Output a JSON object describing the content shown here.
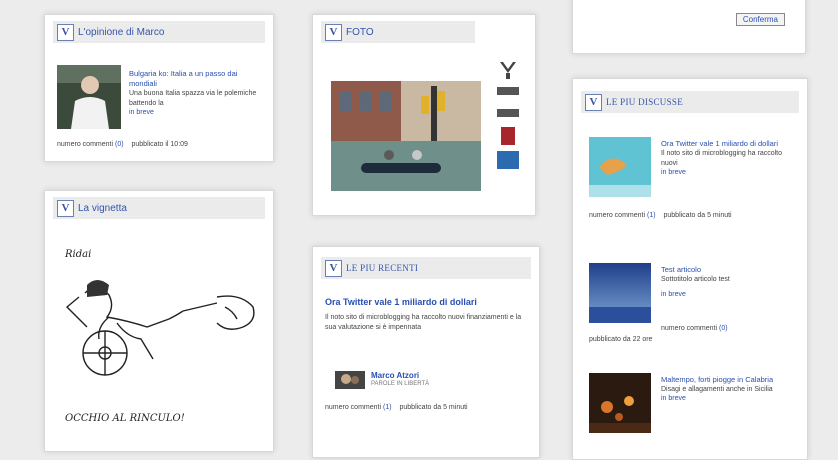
{
  "top_right_button": "Conferma",
  "opinione": {
    "title": "L'opinione di Marco",
    "headline": "Bulgaria ko: Italia a un passo dai mondiali",
    "summary": "Una buona Italia spazza via le polemiche battendo la",
    "more": "in breve",
    "comments_label": "numero commenti",
    "comments_count": "(0)",
    "published": "pubblicato il 10:09"
  },
  "foto": {
    "title": "FOTO"
  },
  "vignetta": {
    "title": "La vignetta",
    "caption_top": "Ridai",
    "caption_bottom": "OCCHIO AL RINCULO!"
  },
  "recenti": {
    "title": "LE PIU RECENTI",
    "headline": "Ora Twitter vale 1 miliardo di dollari",
    "body": "Il noto sito di microblogging ha raccolto nuovi finanziamenti e la sua valutazione si è impennata",
    "author_name": "Marco Atzori",
    "author_section": "PAROLE IN LIBERTÀ",
    "comments_label": "numero commenti",
    "comments_count": "(1)",
    "published": "pubblicato da 5 minuti"
  },
  "discusse": {
    "title": "LE PIU DISCUSSE",
    "items": [
      {
        "headline": "Ora Twitter vale 1 miliardo di dollari",
        "summary": "Il noto sito di microblogging ha raccolto nuovi",
        "more": "in breve",
        "meta": "numero commenti",
        "count": "(1)",
        "published": "pubblicato da 5 minuti"
      },
      {
        "headline": "Test articolo",
        "summary": "Sottotitolo articolo test",
        "more": "in breve",
        "meta": "numero commenti",
        "count": "(0)",
        "published": "pubblicato da 22 ore"
      },
      {
        "headline": "Maltempo, forti piogge in Calabria",
        "summary": "Disagi e allagamenti anche in Sicilia",
        "more": "in breve"
      }
    ]
  }
}
